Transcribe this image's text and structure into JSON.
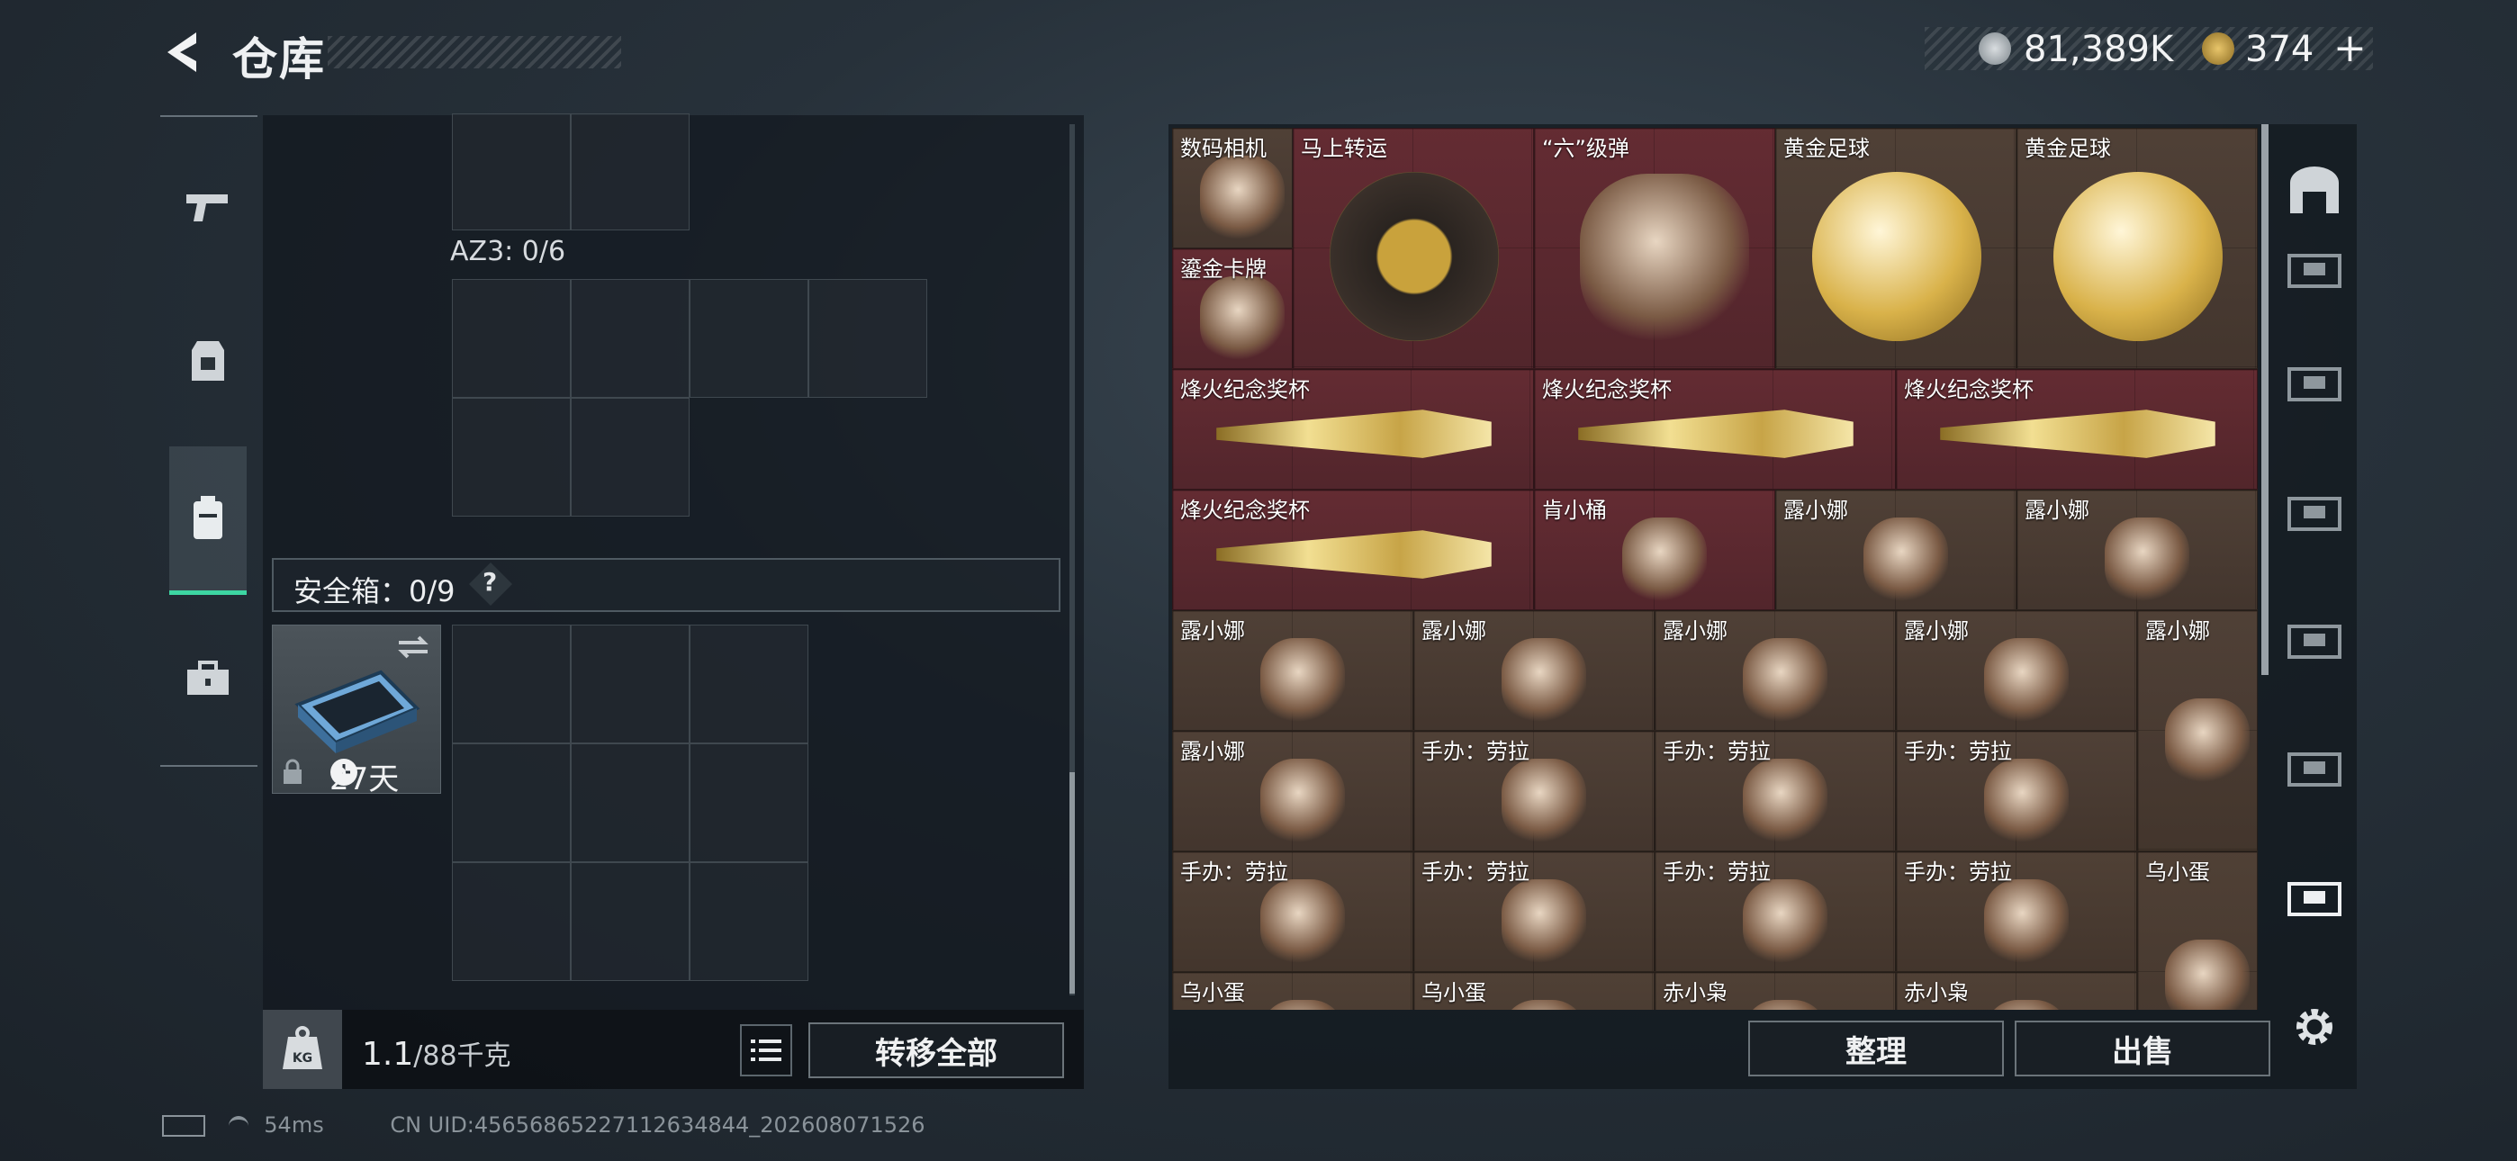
{
  "header": {
    "title": "仓库",
    "currency_primary": "81,389K",
    "currency_secondary": "374",
    "currency_secondary_plus": "+",
    "icons": [
      "back-arrow-icon",
      "silver-coin-icon",
      "gold-triangle-coin-icon"
    ]
  },
  "sidebar_left": {
    "tabs": [
      {
        "name": "weapons",
        "icon": "pistol-icon",
        "active": false
      },
      {
        "name": "armor",
        "icon": "vest-icon",
        "active": false
      },
      {
        "name": "backpack",
        "icon": "backpack-icon",
        "active": true
      },
      {
        "name": "toolbox",
        "icon": "toolbox-icon",
        "active": false
      }
    ]
  },
  "loadout": {
    "az3_label": "AZ3: 0/6",
    "safe_label": "安全箱：0/9",
    "safe_help": "?",
    "safe_days": "27天"
  },
  "footer_left": {
    "weight_value": "1.1",
    "weight_unit": "/88千克",
    "transfer_all": "转移全部"
  },
  "inventory": {
    "items": [
      {
        "label": "数码相机",
        "color": "brown",
        "icon": "camera-icon"
      },
      {
        "label": "马上转运",
        "color": "red",
        "icon": "horse-medallion-icon"
      },
      {
        "label": "“六”级弹",
        "color": "red",
        "icon": "bullet-hand-icon"
      },
      {
        "label": "黄金足球",
        "color": "brown",
        "icon": "gold-football-icon"
      },
      {
        "label": "黄金足球",
        "color": "brown",
        "icon": "gold-football-icon"
      },
      {
        "label": "鎏金卡牌",
        "color": "red",
        "icon": "gold-card-icon"
      },
      {
        "label": "烽火纪念奖杯",
        "color": "red",
        "icon": "trophy-icon"
      },
      {
        "label": "烽火纪念奖杯",
        "color": "red",
        "icon": "trophy-icon"
      },
      {
        "label": "烽火纪念奖杯",
        "color": "red",
        "icon": "trophy-icon"
      },
      {
        "label": "烽火纪念奖杯",
        "color": "red",
        "icon": "trophy-icon"
      },
      {
        "label": "肯小桶",
        "color": "red",
        "icon": "bucket-figure-icon"
      },
      {
        "label": "露小娜",
        "color": "brown",
        "icon": "figure-icon"
      },
      {
        "label": "露小娜",
        "color": "brown",
        "icon": "figure-icon"
      },
      {
        "label": "露小娜",
        "color": "brown",
        "icon": "figure-icon"
      },
      {
        "label": "露小娜",
        "color": "brown",
        "icon": "figure-icon"
      },
      {
        "label": "露小娜",
        "color": "brown",
        "icon": "figure-icon"
      },
      {
        "label": "露小娜",
        "color": "brown",
        "icon": "figure-icon"
      },
      {
        "label": "露小娜",
        "color": "brown",
        "icon": "figure-icon"
      },
      {
        "label": "露小娜",
        "color": "brown",
        "icon": "figure-icon"
      },
      {
        "label": "手办：劳拉",
        "color": "brown",
        "icon": "figure-icon"
      },
      {
        "label": "手办：劳拉",
        "color": "brown",
        "icon": "figure-icon"
      },
      {
        "label": "手办：劳拉",
        "color": "brown",
        "icon": "figure-icon"
      },
      {
        "label": "手办：劳拉",
        "color": "brown",
        "icon": "figure-icon"
      },
      {
        "label": "手办：劳拉",
        "color": "brown",
        "icon": "figure-icon"
      },
      {
        "label": "手办：劳拉",
        "color": "brown",
        "icon": "figure-icon"
      },
      {
        "label": "手办：劳拉",
        "color": "brown",
        "icon": "figure-icon"
      },
      {
        "label": "乌小蛋",
        "color": "brown",
        "icon": "figure-icon"
      },
      {
        "label": "乌小蛋",
        "color": "brown",
        "icon": "figure-icon"
      },
      {
        "label": "乌小蛋",
        "color": "brown",
        "icon": "figure-icon"
      },
      {
        "label": "赤小枭",
        "color": "brown",
        "icon": "figure-icon"
      },
      {
        "label": "赤小枭",
        "color": "brown",
        "icon": "figure-icon"
      }
    ]
  },
  "footer_right": {
    "sort": "整理",
    "sell": "出售"
  },
  "status": {
    "ping": "54ms",
    "uid": "CN UID:4565686522711263484​4_202608071526"
  },
  "colors": {
    "accent_green": "#3dd6a2",
    "slot_red": "#6e2d34",
    "slot_brown": "#564438"
  }
}
